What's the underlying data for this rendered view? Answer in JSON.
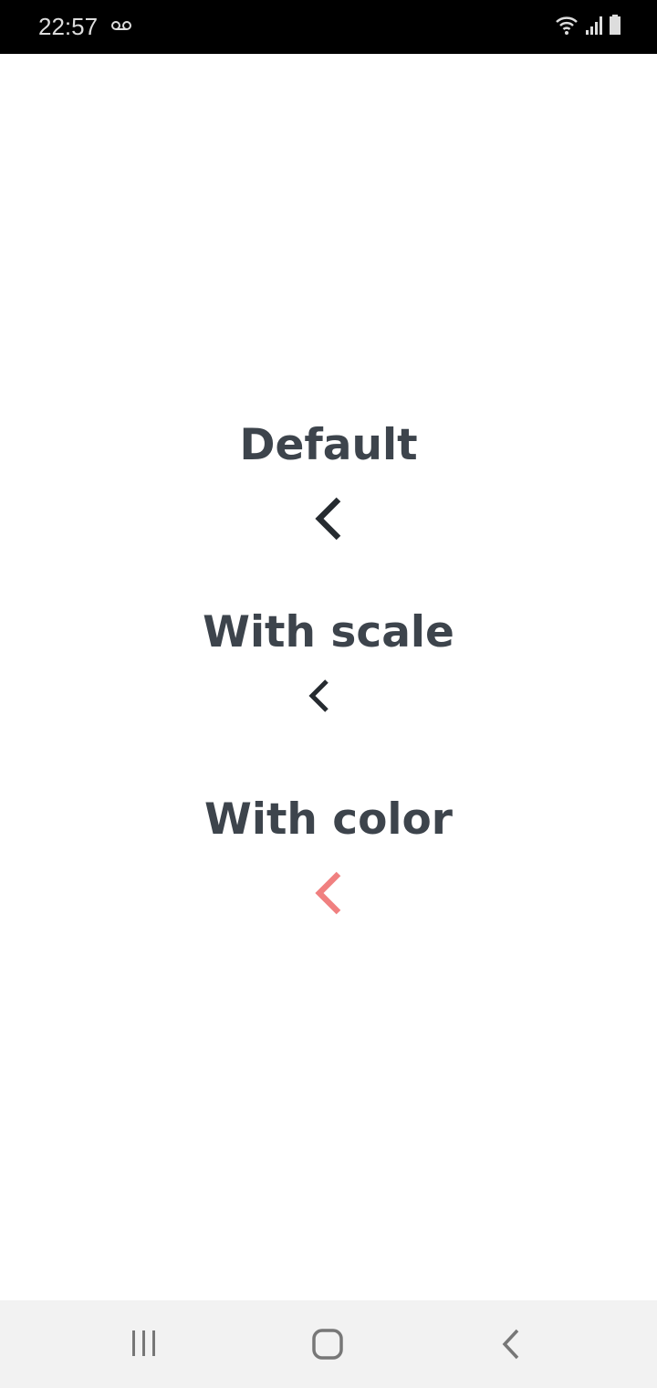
{
  "status_bar": {
    "time": "22:57",
    "icons": [
      "voicemail-icon",
      "wifi-icon",
      "signal-icon",
      "battery-icon"
    ]
  },
  "sections": [
    {
      "title": "Default",
      "icon": "chevron-left-icon",
      "color": "#262b30"
    },
    {
      "title": "With scale",
      "icon": "chevron-left-icon",
      "color": "#262b30"
    },
    {
      "title": "With color",
      "icon": "chevron-left-icon",
      "color": "#f08080"
    }
  ],
  "nav_bar": {
    "icons": [
      "recent-apps-icon",
      "home-icon",
      "back-icon"
    ]
  }
}
